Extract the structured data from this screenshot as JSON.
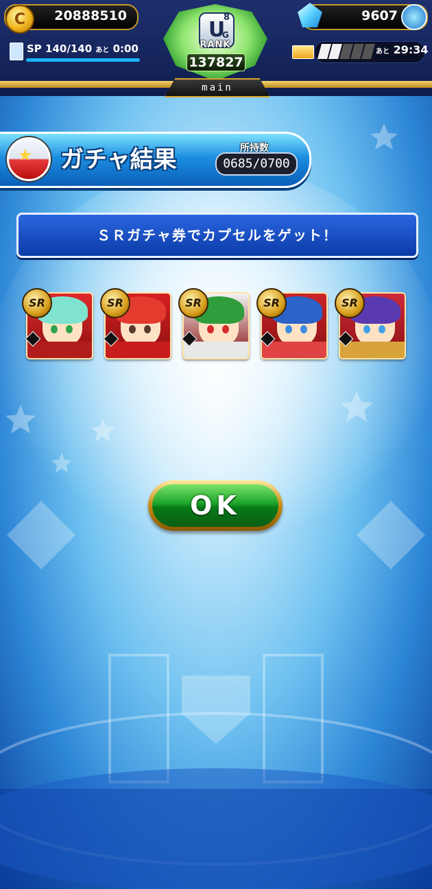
{
  "hud": {
    "coins": "20888510",
    "gems": "9607",
    "sp_label": "SP",
    "sp_value": "140/140",
    "sp_remaining_label": "あと",
    "sp_time": "0:00",
    "timer_label": "あと",
    "timer_value": "29:34",
    "rank_letter": "U",
    "rank_sub": "8",
    "rank_sub2": "G",
    "rank_label": "RANK",
    "rank_value": "137827",
    "tab_label": "main"
  },
  "title": {
    "text": "ガチャ結果",
    "held_label": "所持数",
    "held_value": "0685/0700"
  },
  "message": "ＳＲガチャ券でカプセルをゲット！",
  "cards": [
    {
      "rarity": "SR",
      "bg": "#e0292a",
      "hair": "#7fe3d0",
      "eye": "#2ea34b",
      "jersey": "#b21c1c"
    },
    {
      "rarity": "SR",
      "bg": "#d51f22",
      "hair": "#e43b2e",
      "eye": "#5a3a2a",
      "jersey": "#c81d1d"
    },
    {
      "rarity": "SR",
      "bg": "#f3f3f3",
      "hair": "#2f9d3b",
      "eye": "#d42a2a",
      "jersey": "#e8e8e8"
    },
    {
      "rarity": "SR",
      "bg": "#c92429",
      "hair": "#2b63c9",
      "eye": "#3b8be0",
      "jersey": "#e04343"
    },
    {
      "rarity": "SR",
      "bg": "#cf2a3a",
      "hair": "#5a3ab0",
      "eye": "#3fa0e8",
      "jersey": "#d8a33a"
    }
  ],
  "ok_label": "OK",
  "icons": {
    "coin": "coin-icon",
    "gem": "gem-icon",
    "capsule": "capsule-icon",
    "sp_card": "sp-card-icon",
    "ticket": "ticket-icon"
  }
}
